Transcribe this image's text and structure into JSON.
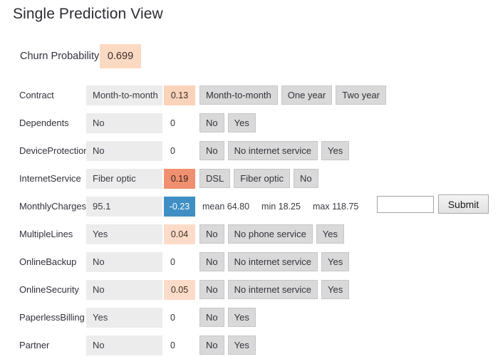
{
  "page_title": "Single Prediction View",
  "churn": {
    "label": "Churn Probability",
    "value": "0.699"
  },
  "stats_labels": {
    "mean_key": "mean",
    "min_key": "min",
    "max_key": "max"
  },
  "monthly_charges_input": {
    "value": "",
    "placeholder": ""
  },
  "submit_label": "Submit",
  "colors": {
    "shap_positive_strong": "#f19070",
    "shap_positive_mid": "#fbd3bb",
    "shap_negative": "#3f8fc4",
    "value_box": "#ececec",
    "churn_highlight": "#fbd9c3",
    "option_button": "#d9d9d9"
  },
  "rows": [
    {
      "feature": "Contract",
      "current_value": "Month-to-month",
      "shap": "0.13",
      "shap_style": "pos-mid",
      "options": [
        "Month-to-month",
        "One year",
        "Two year"
      ]
    },
    {
      "feature": "Dependents",
      "current_value": "No",
      "shap": "0",
      "shap_style": "zero",
      "options": [
        "No",
        "Yes"
      ]
    },
    {
      "feature": "DeviceProtection",
      "current_value": "No",
      "shap": "0",
      "shap_style": "zero",
      "options": [
        "No",
        "No internet service",
        "Yes"
      ]
    },
    {
      "feature": "InternetService",
      "current_value": "Fiber optic",
      "shap": "0.19",
      "shap_style": "pos-strong",
      "options": [
        "DSL",
        "Fiber optic",
        "No"
      ]
    },
    {
      "feature": "MonthlyCharges",
      "current_value": "95.1",
      "shap": "-0.23",
      "shap_style": "neg",
      "options": [],
      "stats": {
        "mean": "64.80",
        "min": "18.25",
        "max": "118.75"
      }
    },
    {
      "feature": "MultipleLines",
      "current_value": "Yes",
      "shap": "0.04",
      "shap_style": "pos-light",
      "options": [
        "No",
        "No phone service",
        "Yes"
      ]
    },
    {
      "feature": "OnlineBackup",
      "current_value": "No",
      "shap": "0",
      "shap_style": "zero",
      "options": [
        "No",
        "No internet service",
        "Yes"
      ]
    },
    {
      "feature": "OnlineSecurity",
      "current_value": "No",
      "shap": "0.05",
      "shap_style": "pos-light",
      "options": [
        "No",
        "No internet service",
        "Yes"
      ]
    },
    {
      "feature": "PaperlessBilling",
      "current_value": "Yes",
      "shap": "0",
      "shap_style": "zero",
      "options": [
        "No",
        "Yes"
      ]
    },
    {
      "feature": "Partner",
      "current_value": "No",
      "shap": "0",
      "shap_style": "zero",
      "options": [
        "No",
        "Yes"
      ]
    }
  ]
}
